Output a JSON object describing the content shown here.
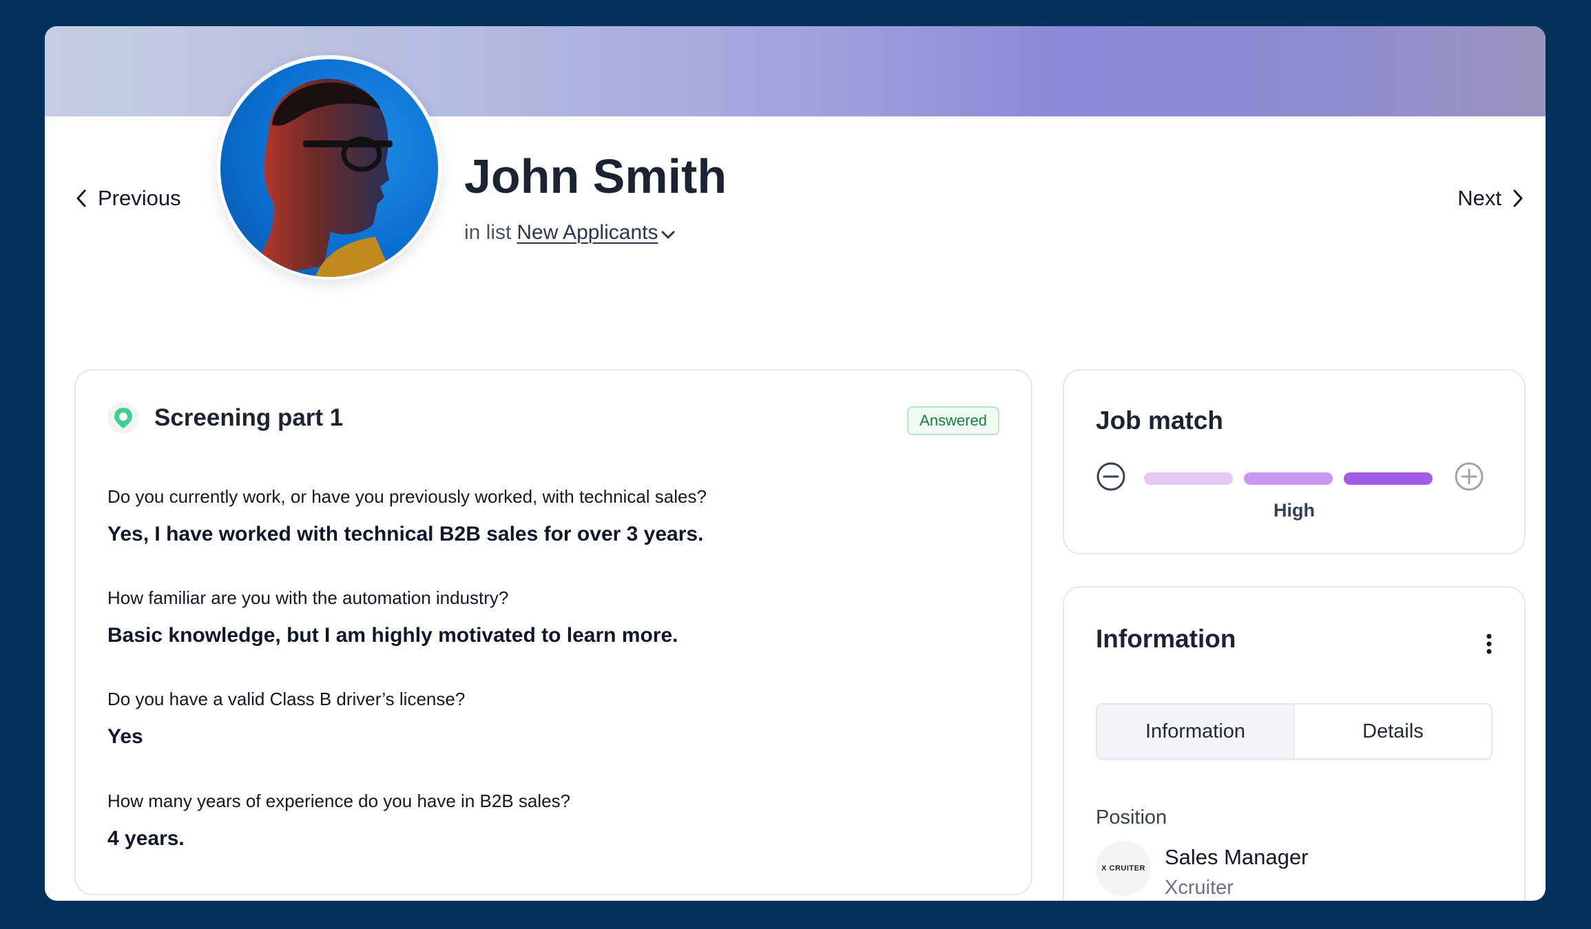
{
  "profile": {
    "name": "John Smith",
    "list_prefix": "in list",
    "list_name": "New Applicants"
  },
  "nav": {
    "previous_label": "Previous",
    "next_label": "Next"
  },
  "screening": {
    "title": "Screening part 1",
    "status": "Answered",
    "items": [
      {
        "question": "Do you currently work, or have you previously worked, with technical sales?",
        "answer": "Yes, I have worked with technical B2B sales for over 3 years."
      },
      {
        "question": "How familiar are you with the automation industry?",
        "answer": "Basic knowledge, but I am highly motivated to learn more."
      },
      {
        "question": "Do you have a valid Class B driver’s license?",
        "answer": "Yes"
      },
      {
        "question": "How many years of experience do you have in B2B sales?",
        "answer": "4 years."
      }
    ]
  },
  "job_match": {
    "title": "Job match",
    "level_label": "High",
    "level_value": 3,
    "level_max": 3
  },
  "information": {
    "title": "Information",
    "tabs": [
      {
        "label": "Information",
        "active": true
      },
      {
        "label": "Details",
        "active": false
      }
    ],
    "position_label": "Position",
    "position_title": "Sales Manager",
    "company": "Xcruiter",
    "company_logo_text": "X CRUITER"
  },
  "colors": {
    "background": "#02325a",
    "badge_green": "#16803c",
    "match_light": "#e3c8f5",
    "match_mid": "#cb96f0",
    "match_dark": "#a25ce6"
  },
  "icons": [
    "chevron-left-icon",
    "chevron-right-icon",
    "chevron-down-icon",
    "location-pin-icon",
    "minus-circle-icon",
    "plus-circle-icon",
    "kebab-menu-icon"
  ]
}
